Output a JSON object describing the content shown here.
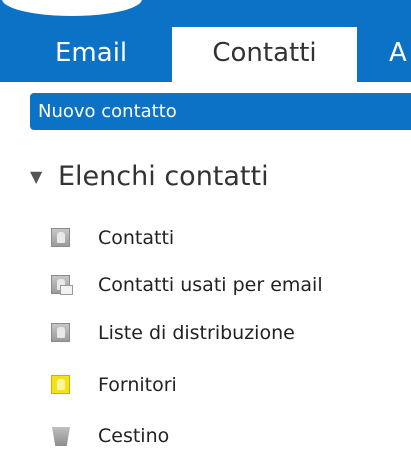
{
  "tabs": [
    {
      "label": "Email"
    },
    {
      "label": "Contatti"
    },
    {
      "label": "A"
    }
  ],
  "new_contact_label": "Nuovo contatto",
  "section": {
    "arrow": "▼",
    "title": "Elenchi contatti"
  },
  "items": [
    {
      "label": "Contatti",
      "icon": "address-book-icon"
    },
    {
      "label": "Contatti usati per email",
      "icon": "email-contacts-book-icon"
    },
    {
      "label": "Liste di distribuzione",
      "icon": "distribution-list-book-icon"
    },
    {
      "label": "Fornitori",
      "icon": "yellow-address-book-icon"
    },
    {
      "label": "Cestino",
      "icon": "trash-icon"
    }
  ],
  "colors": {
    "accent": "#0b72c6"
  }
}
